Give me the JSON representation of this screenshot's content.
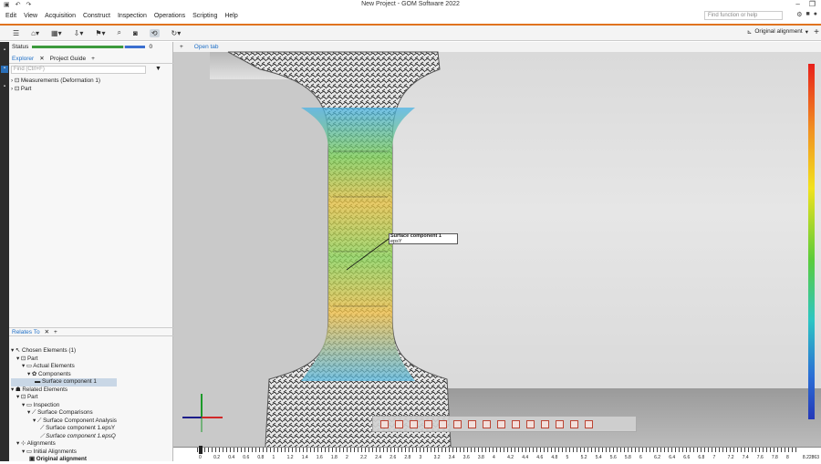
{
  "window": {
    "title": "New Project - GOM Software 2022"
  },
  "menu": [
    "Edit",
    "View",
    "Acquisition",
    "Construct",
    "Inspection",
    "Operations",
    "Scripting",
    "Help"
  ],
  "search": {
    "placeholder": "Find function or help"
  },
  "alignment": {
    "label": "Original alignment"
  },
  "panel": {
    "status_label": "Status",
    "status_count": "0",
    "tabs": [
      "Explorer",
      "Project Guide"
    ],
    "find_placeholder": "Find (Ctrl+F)",
    "explorer_tree": [
      "Measurements (Deformation 1)",
      "Part"
    ],
    "relates_tab": "Relates To",
    "relates_tree": [
      "Chosen Elements (1)",
      "Part",
      "Actual Elements",
      "Components",
      "Surface component 1",
      "Related Elements",
      "Part",
      "Inspection",
      "Surface Comparisons",
      "Surface Component Analysis",
      "Surface component 1.epsY",
      "Surface component 1.epsQ",
      "Alignments",
      "Initial Alignments",
      "Original alignment"
    ]
  },
  "viewport": {
    "tab_label": "Open tab",
    "label_title": "Surface component 1",
    "label_sub": "epsY",
    "ruler_ticks": [
      "0",
      "0.2",
      "0.4",
      "0.6",
      "0.8",
      "1",
      "1.2",
      "1.4",
      "1.6",
      "1.8",
      "2",
      "2.2",
      "2.4",
      "2.6",
      "2.8",
      "3",
      "3.2",
      "3.4",
      "3.6",
      "3.8",
      "4",
      "4.2",
      "4.4",
      "4.6",
      "4.8",
      "5",
      "5.2",
      "5.4",
      "5.6",
      "5.8",
      "6",
      "6.2",
      "6.4",
      "6.6",
      "6.8",
      "7",
      "7.2",
      "7.4",
      "7.6",
      "7.8",
      "8"
    ],
    "ruler_end": "8.22863"
  },
  "colors": {
    "accent": "#e0731f",
    "active_tab": "#1e6fc7"
  }
}
